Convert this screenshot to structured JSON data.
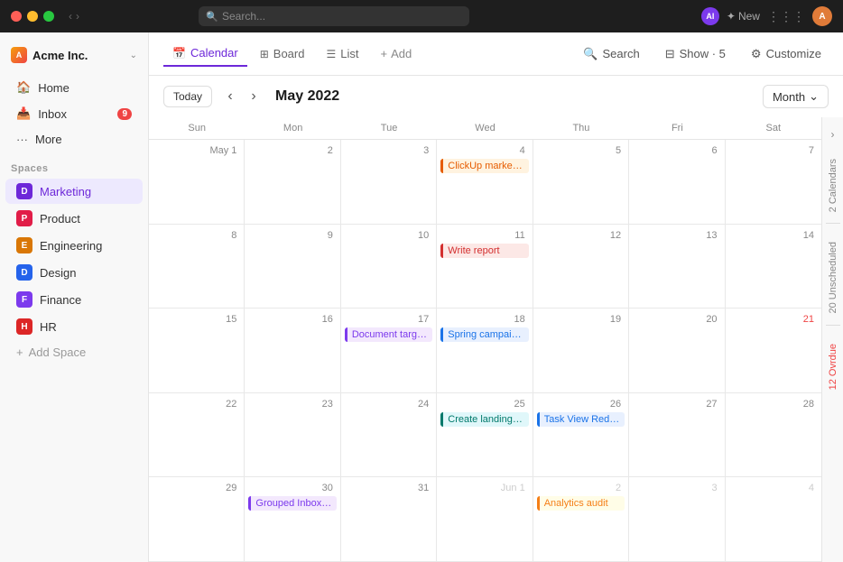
{
  "titlebar": {
    "search_placeholder": "Search...",
    "ai_label": "AI",
    "new_label": "New",
    "avatar_initials": "A"
  },
  "sidebar": {
    "brand": {
      "name": "Acme Inc.",
      "icon_letter": "A"
    },
    "nav_items": [
      {
        "id": "home",
        "label": "Home",
        "icon": "🏠"
      },
      {
        "id": "inbox",
        "label": "Inbox",
        "icon": "📥",
        "badge": "9"
      },
      {
        "id": "more",
        "label": "More",
        "icon": "•••"
      }
    ],
    "section_label": "Spaces",
    "spaces": [
      {
        "id": "marketing",
        "label": "Marketing",
        "icon_letter": "D",
        "color": "#6d28d9",
        "active": true
      },
      {
        "id": "product",
        "label": "Product",
        "icon_letter": "P",
        "color": "#e11d48"
      },
      {
        "id": "engineering",
        "label": "Engineering",
        "icon_letter": "E",
        "color": "#d97706"
      },
      {
        "id": "design",
        "label": "Design",
        "icon_letter": "D",
        "color": "#2563eb"
      },
      {
        "id": "finance",
        "label": "Finance",
        "icon_letter": "F",
        "color": "#7c3aed"
      },
      {
        "id": "hr",
        "label": "HR",
        "icon_letter": "H",
        "color": "#dc2626"
      }
    ],
    "add_space_label": "Add Space"
  },
  "toolbar": {
    "tabs": [
      {
        "id": "calendar",
        "label": "Calendar",
        "icon": "📅",
        "active": true
      },
      {
        "id": "board",
        "label": "Board",
        "icon": "⊞"
      },
      {
        "id": "list",
        "label": "List",
        "icon": "☰"
      }
    ],
    "add_label": "Add",
    "search_label": "Search",
    "show_label": "Show · 5",
    "customize_label": "Customize"
  },
  "calendar": {
    "today_label": "Today",
    "title": "May 2022",
    "month_label": "Month",
    "day_headers": [
      "Sun",
      "Mon",
      "Tue",
      "Wed",
      "Thu",
      "Fri",
      "Sat"
    ],
    "weeks": [
      {
        "days": [
          {
            "num": "May 1",
            "other": false,
            "events": []
          },
          {
            "num": "2",
            "events": []
          },
          {
            "num": "3",
            "events": []
          },
          {
            "num": "4",
            "events": [
              {
                "label": "ClickUp marketing plan",
                "style": "event-orange"
              }
            ]
          },
          {
            "num": "5",
            "events": []
          },
          {
            "num": "6",
            "events": []
          },
          {
            "num": "7",
            "events": []
          }
        ]
      },
      {
        "days": [
          {
            "num": "8",
            "events": []
          },
          {
            "num": "9",
            "events": []
          },
          {
            "num": "10",
            "events": []
          },
          {
            "num": "11",
            "events": [
              {
                "label": "Write report",
                "style": "event-red"
              }
            ]
          },
          {
            "num": "12",
            "events": []
          },
          {
            "num": "13",
            "events": []
          },
          {
            "num": "14",
            "events": []
          }
        ]
      },
      {
        "days": [
          {
            "num": "15",
            "events": []
          },
          {
            "num": "16",
            "events": []
          },
          {
            "num": "17",
            "events": [
              {
                "label": "Document target users",
                "style": "event-purple"
              }
            ]
          },
          {
            "num": "18",
            "events": [
              {
                "label": "Spring campaign image assets",
                "style": "event-blue"
              }
            ]
          },
          {
            "num": "19",
            "events": []
          },
          {
            "num": "20",
            "events": []
          },
          {
            "num": "21",
            "overdue": true,
            "events": []
          }
        ]
      },
      {
        "days": [
          {
            "num": "22",
            "events": []
          },
          {
            "num": "23",
            "events": []
          },
          {
            "num": "24",
            "events": []
          },
          {
            "num": "25",
            "events": [
              {
                "label": "Create landing page",
                "style": "event-teal"
              }
            ]
          },
          {
            "num": "26",
            "events": [
              {
                "label": "Task View Redesign",
                "style": "event-blue"
              }
            ]
          },
          {
            "num": "27",
            "events": []
          },
          {
            "num": "28",
            "events": []
          }
        ]
      },
      {
        "days": [
          {
            "num": "29",
            "events": []
          },
          {
            "num": "30",
            "events": []
          },
          {
            "num": "31",
            "events": []
          },
          {
            "num": "Jun 1",
            "events": []
          },
          {
            "num": "2",
            "events": []
          },
          {
            "num": "3",
            "events": []
          },
          {
            "num": "4",
            "events": []
          }
        ]
      }
    ],
    "grouped_label": "Grouped Inbox Comments",
    "analytics_label": "Analytics audit"
  },
  "right_panel": {
    "calendars_label": "2 Calendars",
    "unscheduled_label": "20 Unscheduled",
    "overdue_label": "12 Ovrdue"
  }
}
